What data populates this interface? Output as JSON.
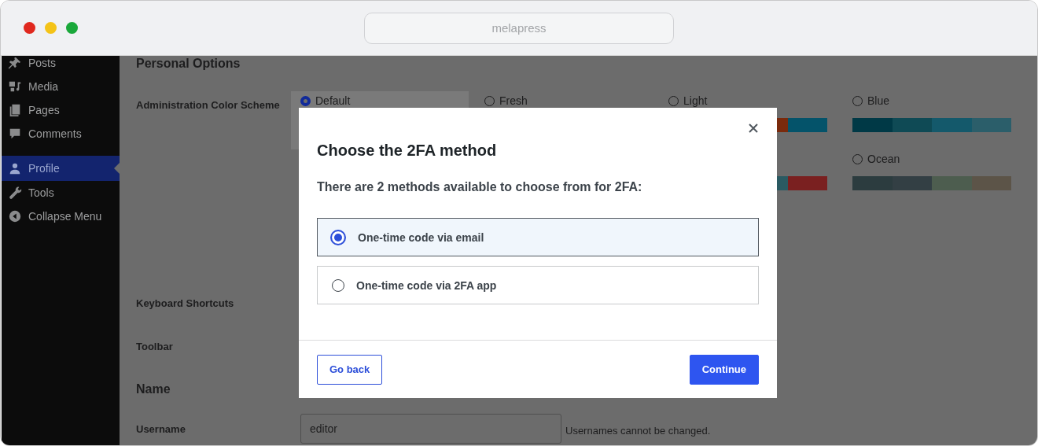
{
  "browser": {
    "address": "melapress"
  },
  "sidebar": {
    "items": [
      {
        "label": "Posts",
        "selected": false
      },
      {
        "label": "Media",
        "selected": false
      },
      {
        "label": "Pages",
        "selected": false
      },
      {
        "label": "Comments",
        "selected": false
      },
      {
        "label": "Profile",
        "selected": true
      },
      {
        "label": "Tools",
        "selected": false
      },
      {
        "label": "Collapse Menu",
        "selected": false
      }
    ]
  },
  "page": {
    "heading": "Personal Options",
    "color_scheme": {
      "label": "Administration Color Scheme",
      "options": [
        {
          "label": "Default",
          "selected": true
        },
        {
          "label": "Fresh",
          "selected": false
        },
        {
          "label": "Light",
          "selected": false,
          "swatches": [
            {
              "color": "#7a2a0c"
            },
            {
              "color": "#04536a"
            }
          ]
        },
        {
          "label": "Blue",
          "selected": false,
          "swatches": [
            {
              "color": "#003946"
            },
            {
              "color": "#0f4a55"
            },
            {
              "color": "#14596b"
            },
            {
              "color": "#2b5e6a"
            }
          ]
        },
        {
          "selected": false,
          "swatches": [
            {
              "color": "#2a5a62"
            },
            {
              "color": "#7a2020"
            }
          ]
        },
        {
          "label": "Ocean",
          "selected": false,
          "swatches": [
            {
              "color": "#2c3c3f"
            },
            {
              "color": "#333f44"
            },
            {
              "color": "#4d5d4f"
            },
            {
              "color": "#5c5448"
            }
          ]
        }
      ]
    },
    "keyboard_shortcuts": {
      "label": "Keyboard Shortcuts"
    },
    "toolbar": {
      "label": "Toolbar"
    },
    "name_heading": "Name",
    "username": {
      "label": "Username",
      "value": "editor",
      "note": "Usernames cannot be changed."
    }
  },
  "modal": {
    "title": "Choose the 2FA method",
    "subtitle": "There are 2 methods available to choose from for 2FA:",
    "options": [
      {
        "label": "One-time code via email",
        "selected": true
      },
      {
        "label": "One-time code via 2FA app",
        "selected": false
      }
    ],
    "buttons": [
      {
        "label": "Go back",
        "kind": "secondary"
      },
      {
        "label": "Continue",
        "kind": "primary"
      }
    ]
  }
}
